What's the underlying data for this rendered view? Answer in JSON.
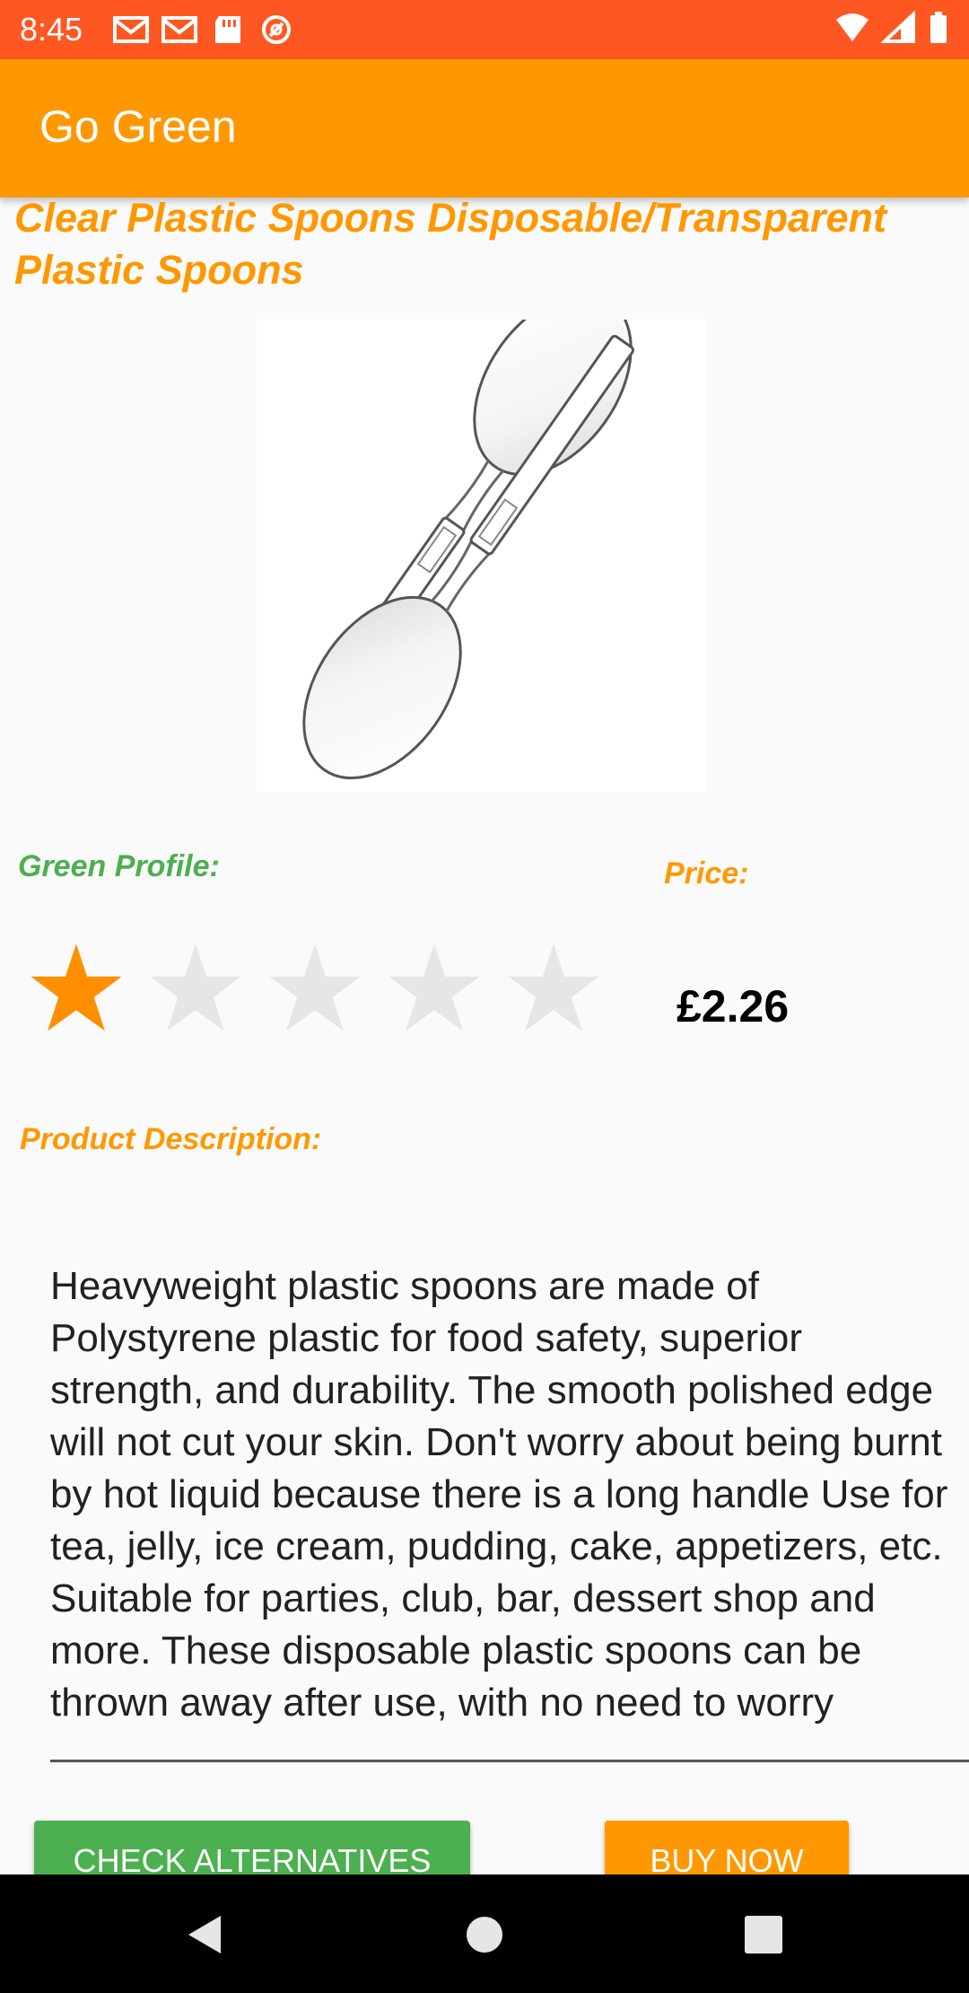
{
  "status_bar": {
    "time": "8:45",
    "left_icons": [
      "gmail-icon",
      "gmail-icon",
      "sd-card-icon",
      "sync-icon"
    ],
    "right_icons": [
      "wifi-icon",
      "signal-icon",
      "battery-icon"
    ],
    "color": "#ff5722"
  },
  "app_bar": {
    "title": "Go Green",
    "color": "#ff9800"
  },
  "product": {
    "title": "Clear Plastic Spoons Disposable/Transparent Plastic Spoons",
    "image": "plastic-spoons-image",
    "green_profile_label": "Green Profile:",
    "green_rating": 1,
    "green_rating_max": 5,
    "price_label": "Price:",
    "price": "£2.26",
    "description_label": "Product Description:",
    "description": "Heavyweight plastic spoons are made of Polystyrene plastic for food safety, superior strength, and durability. The smooth polished edge will not cut your skin. Don't worry about being burnt by hot liquid because there is a long handle Use for tea, jelly, ice cream, pudding, cake, appetizers, etc. Suitable for parties, club, bar, dessert shop and more. These disposable plastic spoons can be thrown away after use, with no need to worry"
  },
  "buttons": {
    "check_alternatives": "CHECK ALTERNATIVES",
    "buy_now": "BUY NOW"
  },
  "nav_bar": {
    "icons": [
      "back-icon",
      "home-icon",
      "recents-icon"
    ]
  },
  "colors": {
    "accent": "#ff9800",
    "green": "#4caf50",
    "status": "#ff5722",
    "star_filled": "#ff8f00",
    "star_empty": "#e6e6e6"
  }
}
